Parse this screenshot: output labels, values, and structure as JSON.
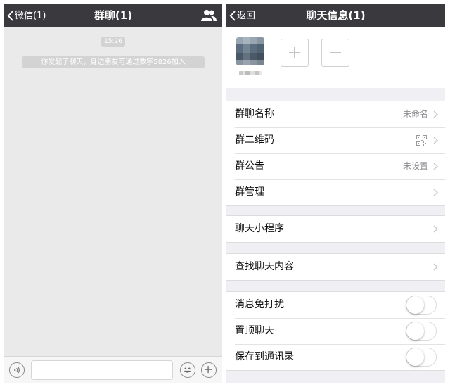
{
  "left": {
    "nav": {
      "back_label": "微信(1)",
      "title": "群聊(1)",
      "right_icon": "group-members-icon"
    },
    "chat": {
      "time": "15:26",
      "system_message": "你发起了聊天，身边朋友可通过数字5826加入"
    },
    "input_bar": {
      "voice_icon": "voice-icon",
      "emoji_icon": "emoji-icon",
      "plus_icon": "plus-icon"
    }
  },
  "right": {
    "nav": {
      "back_label": "返回",
      "title": "聊天信息(1)"
    },
    "members": {
      "add_icon": "add-member-icon",
      "remove_icon": "remove-member-icon"
    },
    "groups": [
      {
        "rows": [
          {
            "label": "群聊名称",
            "value": "未命名"
          },
          {
            "label": "群二维码",
            "icon": "qr-code-icon"
          },
          {
            "label": "群公告",
            "value": "未设置"
          },
          {
            "label": "群管理"
          }
        ]
      },
      {
        "rows": [
          {
            "label": "聊天小程序"
          }
        ]
      },
      {
        "rows": [
          {
            "label": "查找聊天内容"
          }
        ]
      },
      {
        "rows": [
          {
            "label": "消息免打扰",
            "toggle": false
          },
          {
            "label": "置顶聊天",
            "toggle": false
          },
          {
            "label": "保存到通讯录",
            "toggle": false
          }
        ]
      }
    ]
  }
}
